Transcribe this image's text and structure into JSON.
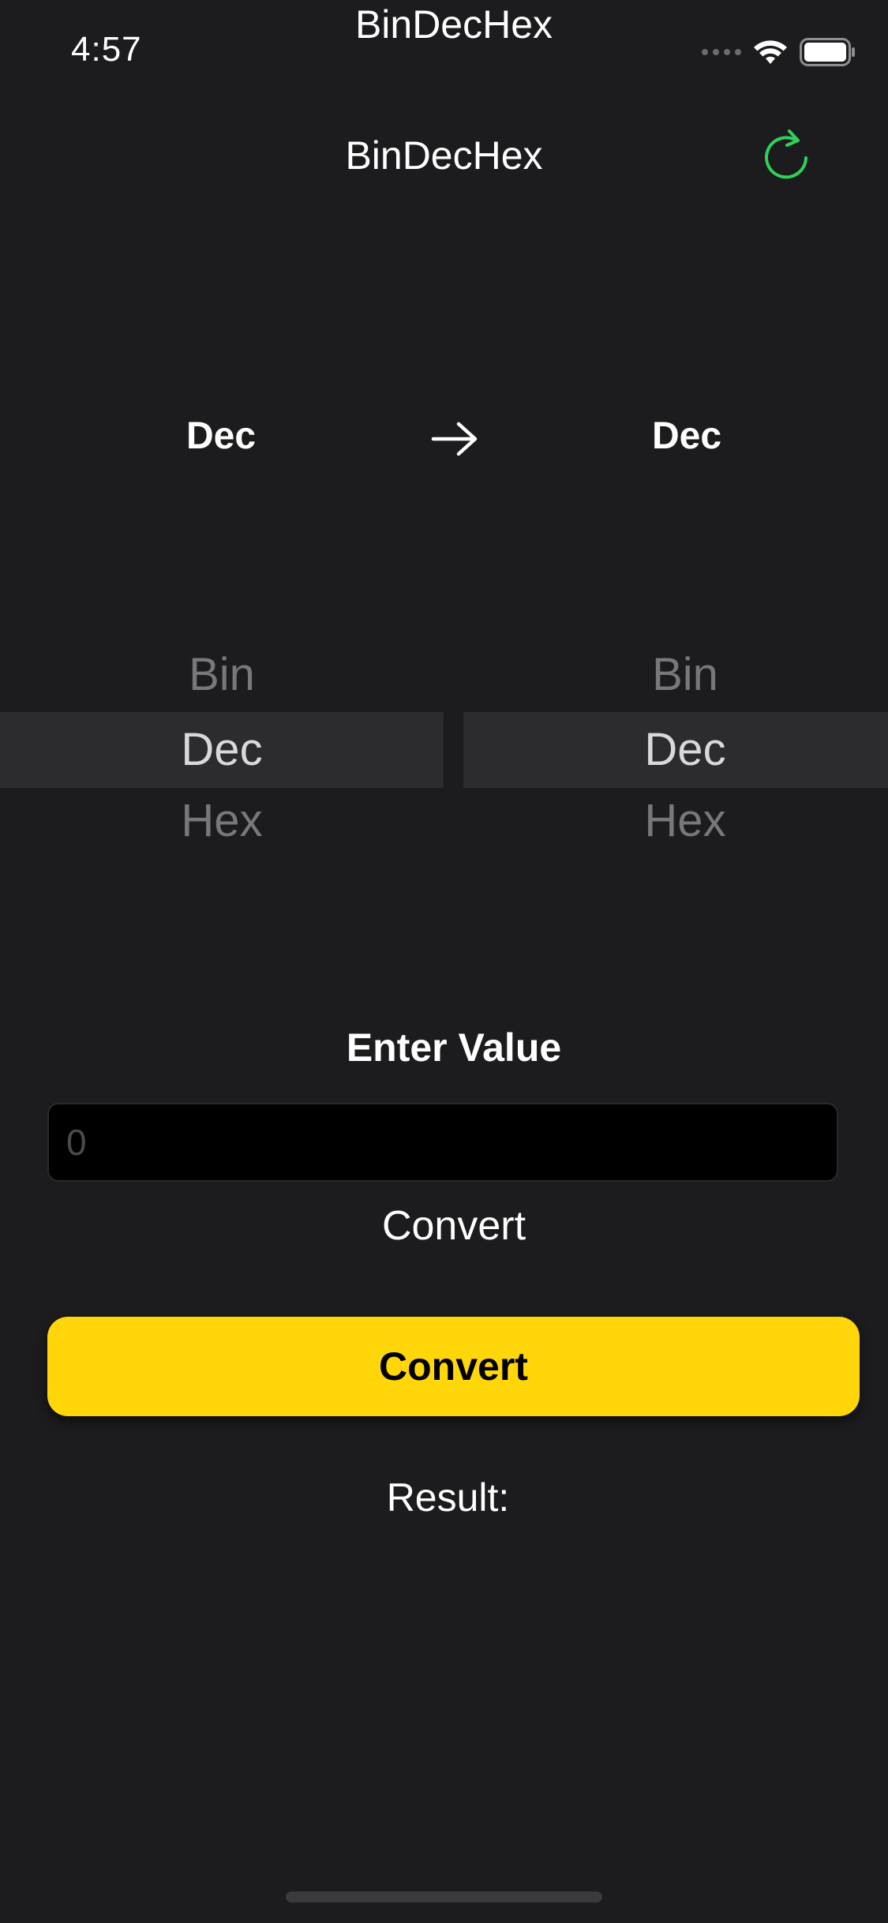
{
  "status_bar": {
    "time": "4:57",
    "app_name": "BinDecHex",
    "icons": [
      "cellular-signal-icon",
      "wifi-icon",
      "battery-icon"
    ]
  },
  "nav": {
    "title": "BinDecHex",
    "refresh_icon": "refresh-icon",
    "accent_color": "#30d158"
  },
  "summary": {
    "from": "Dec",
    "to": "Dec",
    "arrow_icon": "arrow-right-icon"
  },
  "pickers": {
    "from": {
      "options": [
        "Bin",
        "Dec",
        "Hex"
      ],
      "selected": "Dec"
    },
    "to": {
      "options": [
        "Bin",
        "Dec",
        "Hex"
      ],
      "selected": "Dec"
    }
  },
  "input": {
    "label": "Enter Value",
    "placeholder": "0",
    "value": ""
  },
  "convert_text": "Convert",
  "convert_button": {
    "label": "Convert",
    "color": "#ffd60a"
  },
  "result": {
    "label": "Result:"
  }
}
